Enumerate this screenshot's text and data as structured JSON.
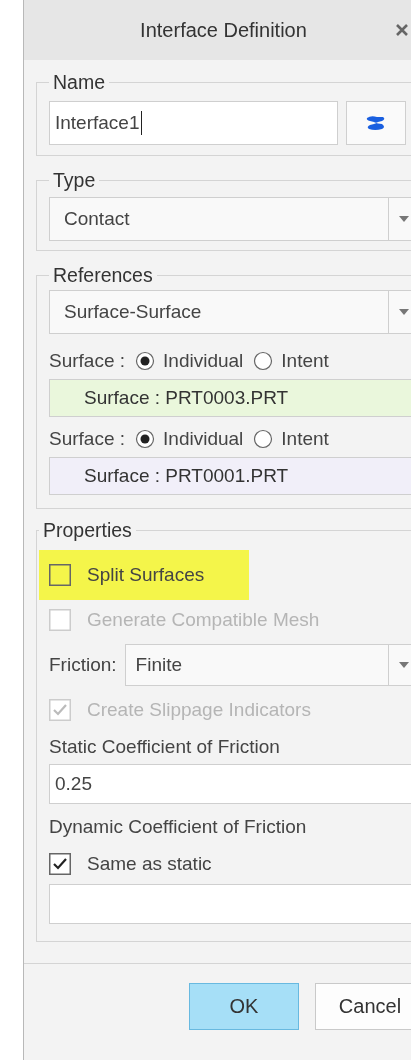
{
  "window": {
    "title": "Interface Definition"
  },
  "name": {
    "legend": "Name",
    "value": "Interface1"
  },
  "type": {
    "legend": "Type",
    "value": "Contact"
  },
  "references": {
    "legend": "References",
    "value": "Surface-Surface",
    "surfaces": [
      {
        "label": "Surface :",
        "options": [
          {
            "label": "Individual",
            "selected": true
          },
          {
            "label": "Intent",
            "selected": false
          }
        ],
        "collector": "Surface : PRT0003.PRT",
        "color": "#eaf7dc"
      },
      {
        "label": "Surface :",
        "options": [
          {
            "label": "Individual",
            "selected": true
          },
          {
            "label": "Intent",
            "selected": false
          }
        ],
        "collector": "Surface : PRT0001.PRT",
        "color": "#f1eff9"
      }
    ]
  },
  "properties": {
    "legend": "Properties",
    "items": [
      {
        "kind": "checkbox",
        "label": "Split Surfaces",
        "checked": false,
        "disabled": false,
        "highlighted": true
      },
      {
        "kind": "checkbox",
        "label": "Generate Compatible Mesh",
        "checked": false,
        "disabled": true,
        "highlighted": false
      },
      {
        "kind": "select",
        "label": "Friction:",
        "value": "Finite"
      },
      {
        "kind": "checkbox",
        "label": "Create Slippage Indicators",
        "checked": true,
        "disabled": true,
        "highlighted": false
      },
      {
        "kind": "label",
        "label": "Static Coefficient of Friction"
      },
      {
        "kind": "input",
        "value": "0.25"
      },
      {
        "kind": "label",
        "label": "Dynamic Coefficient of Friction"
      },
      {
        "kind": "checkbox",
        "label": "Same as static",
        "checked": true,
        "disabled": false,
        "highlighted": false
      },
      {
        "kind": "input"
      }
    ]
  },
  "buttons": [
    {
      "label": "OK",
      "default": true
    },
    {
      "label": "Cancel",
      "default": false
    }
  ]
}
